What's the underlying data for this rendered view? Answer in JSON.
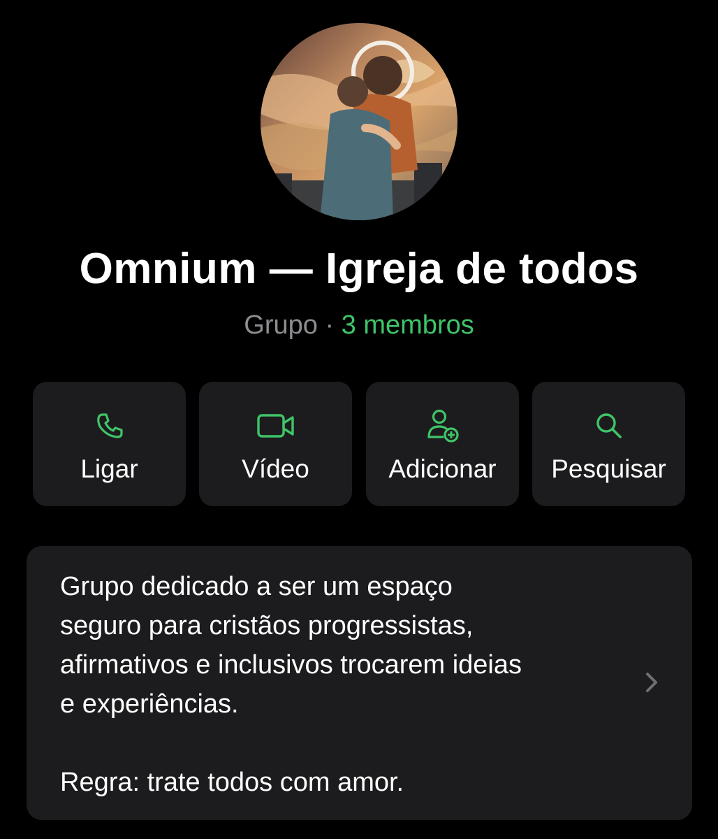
{
  "group": {
    "name": "Omnium — Igreja de todos",
    "kind": "Grupo",
    "separator": "·",
    "members": "3 membros",
    "avatar_icon": "group-avatar-painting"
  },
  "actions": [
    {
      "label": "Ligar",
      "icon": "phone-icon"
    },
    {
      "label": "Vídeo",
      "icon": "video-camera-icon"
    },
    {
      "label": "Adicionar",
      "icon": "add-person-icon"
    },
    {
      "label": "Pesquisar",
      "icon": "search-icon"
    }
  ],
  "description": {
    "lines": [
      "Grupo dedicado a ser um espaço",
      "seguro para cristãos progressistas,",
      "afirmativos e inclusivos trocarem ideias",
      "e experiências."
    ],
    "rule": "Regra: trate todos com amor.",
    "chevron_icon": "chevron-right-icon"
  },
  "colors": {
    "background": "#000000",
    "card": "#1c1c1e",
    "accent_green": "#3fc468",
    "secondary_text": "#8d8d92"
  }
}
